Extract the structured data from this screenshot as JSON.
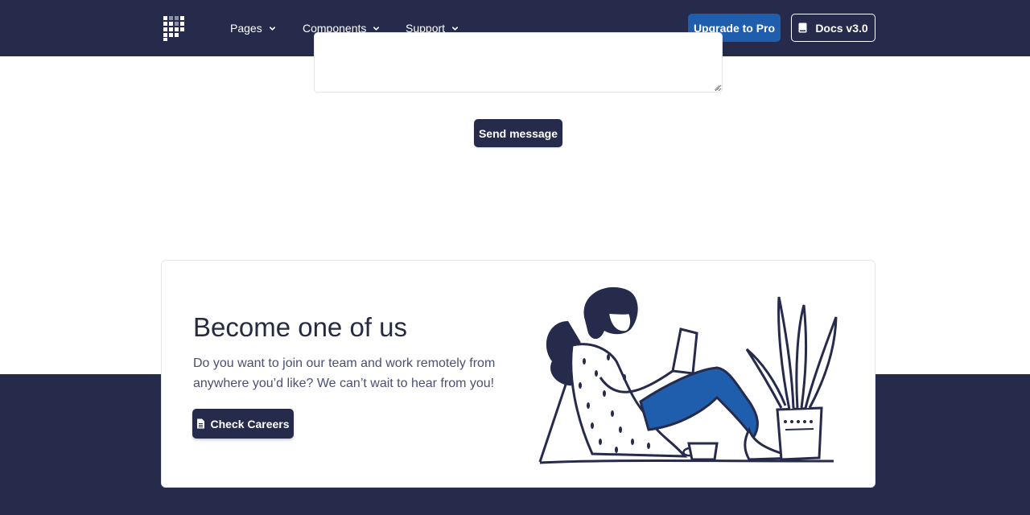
{
  "navbar": {
    "brand_icon": "grid-logo-icon",
    "items": [
      {
        "label": "Pages"
      },
      {
        "label": "Components"
      },
      {
        "label": "Support"
      }
    ],
    "upgrade_label": "Upgrade to Pro",
    "docs_label": "Docs v3.0",
    "docs_icon": "book-icon"
  },
  "form": {
    "message_value": "",
    "send_label": "Send message"
  },
  "careers": {
    "title": "Become one of us",
    "text": "Do you want to join our team and work remotely from anywhere you’d like? We can’t wait to hear from you!",
    "button_label": "Check Careers",
    "button_icon": "document-icon"
  },
  "colors": {
    "navbar_bg": "#262b4c",
    "primary_blue": "#1f5dad",
    "dark": "#262b4c"
  }
}
